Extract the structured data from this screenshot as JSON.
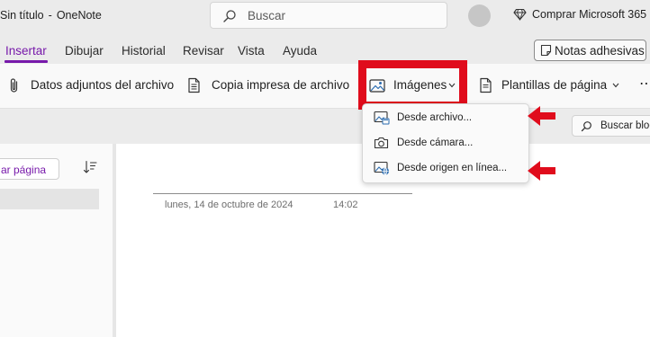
{
  "window": {
    "doc_title": "Sin título",
    "separator": "-",
    "app_name": "OneNote"
  },
  "search": {
    "placeholder": "Buscar"
  },
  "header": {
    "buy_label": "Comprar Microsoft 365"
  },
  "menu": {
    "tabs": [
      "Insertar",
      "Dibujar",
      "Historial",
      "Revisar",
      "Vista",
      "Ayuda"
    ],
    "active": "Insertar",
    "sticky_notes": "Notas adhesivas"
  },
  "ribbon": {
    "attachment": "Datos adjuntos del archivo",
    "printout": "Copia impresa de archivo",
    "images": "Imágenes",
    "templates": "Plantillas de página",
    "more": "⋯"
  },
  "images_menu": {
    "items": [
      "Desde archivo...",
      "Desde cámara...",
      "Desde origen en línea..."
    ]
  },
  "side_search": {
    "label": "Buscar bloc"
  },
  "pages": {
    "add_page": "ar página"
  },
  "note": {
    "date": "lunes, 14 de octubre de 2024",
    "time": "14:02"
  },
  "colors": {
    "accent": "#7719aa",
    "highlight_red": "#e00c1c"
  }
}
